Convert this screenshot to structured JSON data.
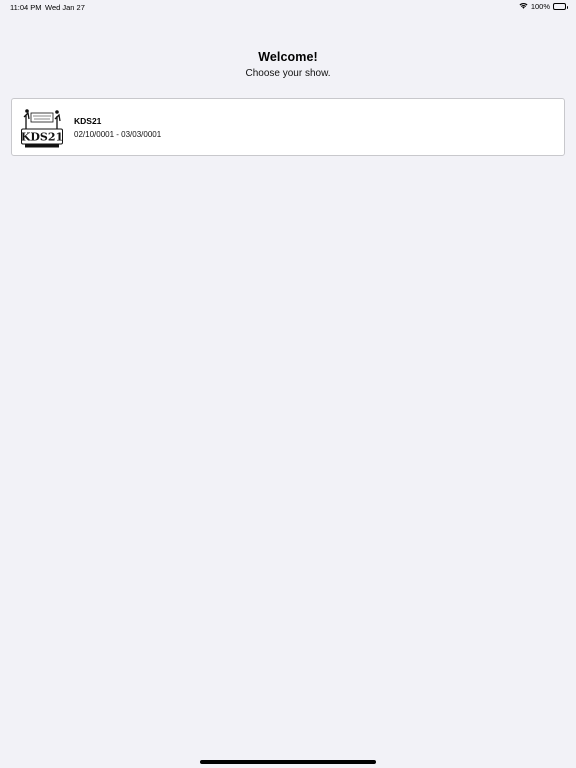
{
  "status_bar": {
    "time": "11:04 PM",
    "date": "Wed Jan 27",
    "battery": "100%",
    "icons": [
      "wifi-icon",
      "battery-icon"
    ]
  },
  "header": {
    "title": "Welcome!",
    "subtitle": "Choose your show."
  },
  "shows": [
    {
      "name": "KDS21",
      "dates": "02/10/0001 - 03/03/0001",
      "logo_text": "KDS21"
    }
  ],
  "colors": {
    "background": "#f2f2f7",
    "card": "#ffffff",
    "card_border": "#c8c8cc"
  }
}
